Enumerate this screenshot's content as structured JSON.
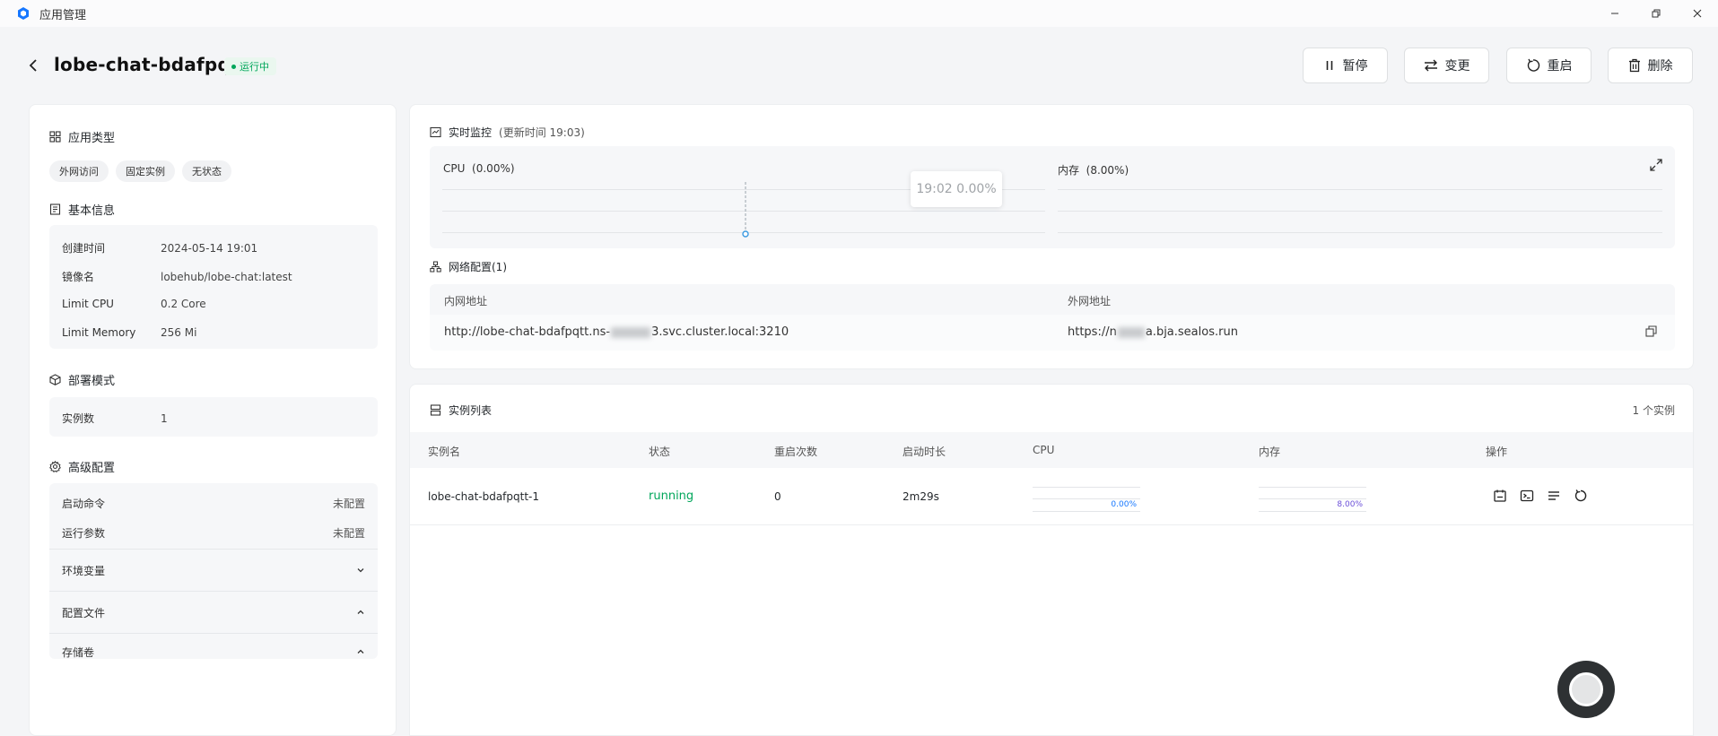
{
  "window": {
    "title": "应用管理",
    "icon": "app-hexagon-icon",
    "accent": "#1677ff"
  },
  "header": {
    "app_name": "lobe-chat-bdafpqtt",
    "status": "运行中",
    "status_color": "#00a65a",
    "actions": {
      "pause": "暂停",
      "change": "变更",
      "restart": "重启",
      "delete": "删除"
    }
  },
  "sidebar": {
    "app_type": {
      "title": "应用类型",
      "tags": [
        "外网访问",
        "固定实例",
        "无状态"
      ]
    },
    "basic_info": {
      "title": "基本信息",
      "rows": [
        {
          "label": "创建时间",
          "value": "2024-05-14 19:01"
        },
        {
          "label": "镜像名",
          "value": "lobehub/lobe-chat:latest"
        },
        {
          "label": "Limit CPU",
          "value": "0.2 Core"
        },
        {
          "label": "Limit Memory",
          "value": "256 Mi"
        }
      ]
    },
    "deploy_mode": {
      "title": "部署模式",
      "rows": [
        {
          "label": "实例数",
          "value": "1"
        }
      ]
    },
    "advanced": {
      "title": "高级配置",
      "rows": [
        {
          "label": "启动命令",
          "value": "未配置"
        },
        {
          "label": "运行参数",
          "value": "未配置"
        }
      ],
      "collapsibles": [
        "环境变量",
        "配置文件",
        "存储卷"
      ]
    }
  },
  "monitor": {
    "title": "实时监控",
    "update_time": "(更新时间  19:03)",
    "cpu_label": "CPU",
    "cpu_value": "(0.00%)",
    "mem_label": "内存",
    "mem_value": "(8.00%)",
    "tooltip": "19:02 0.00%"
  },
  "network": {
    "title": "网络配置(1)",
    "internal_header": "内网地址",
    "external_header": "外网地址",
    "internal_prefix": "http://lobe-chat-bdafpqtt.ns-",
    "internal_suffix": "3.svc.cluster.local:3210",
    "external_prefix": "https://n",
    "external_suffix": "a.bja.sealos.run"
  },
  "instances": {
    "title": "实例列表",
    "count": "1 个实例",
    "columns": [
      "实例名",
      "状态",
      "重启次数",
      "启动时长",
      "CPU",
      "内存",
      "操作"
    ],
    "rows": [
      {
        "name": "lobe-chat-bdafpqtt-1",
        "status": "running",
        "restarts": "0",
        "uptime": "2m29s",
        "cpu": "0.00%",
        "mem": "8.00%"
      }
    ],
    "op_icons": [
      "detail-icon",
      "terminal-icon",
      "logs-icon",
      "restart-icon"
    ]
  }
}
